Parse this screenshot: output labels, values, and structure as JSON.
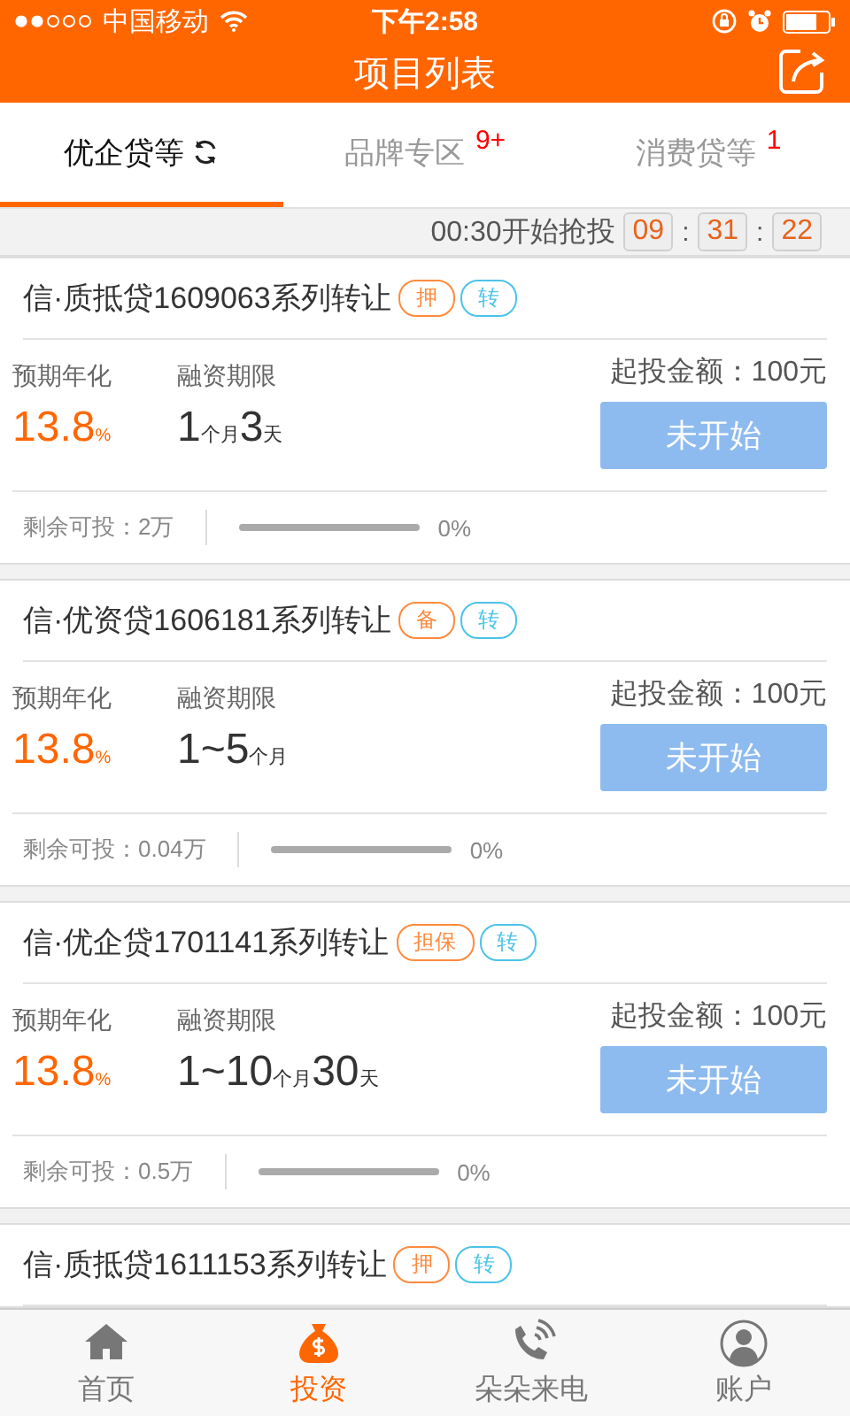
{
  "status_bar": {
    "carrier": "中国移动",
    "time": "下午2:58"
  },
  "nav": {
    "title": "项目列表"
  },
  "tabs": [
    {
      "label": "优企贷等",
      "selected": true,
      "refresh": true
    },
    {
      "label": "品牌专区",
      "selected": false,
      "badge": "9+"
    },
    {
      "label": "消费贷等",
      "selected": false,
      "badge": "1"
    }
  ],
  "countdown": {
    "label": "00:30开始抢投",
    "hours": "09",
    "sep1": ":",
    "minutes": "31",
    "sep2": ":",
    "seconds": "22"
  },
  "projects": [
    {
      "title": "信·质抵贷1609063系列转让",
      "tags": [
        {
          "text": "押",
          "color": "#ff8a3d"
        },
        {
          "text": "转",
          "color": "#4cc3e8"
        }
      ],
      "rate_label": "预期年化",
      "rate": "13.8",
      "rate_unit": "%",
      "term_label": "融资期限",
      "term": [
        {
          "text": "1",
          "kind": "number"
        },
        {
          "text": "个月",
          "kind": "unit"
        },
        {
          "text": "3",
          "kind": "number"
        },
        {
          "text": "天",
          "kind": "unit"
        }
      ],
      "min_invest": "起投金额：100元",
      "button": "未开始",
      "remaining": "剩余可投：2万",
      "level": 0,
      "percent": "0%"
    },
    {
      "title": "信·优资贷1606181系列转让",
      "tags": [
        {
          "text": "备",
          "color": "#ff8a3d"
        },
        {
          "text": "转",
          "color": "#4cc3e8"
        }
      ],
      "rate_label": "预期年化",
      "rate": "13.8",
      "rate_unit": "%",
      "term_label": "融资期限",
      "term": [
        {
          "text": "1~5",
          "kind": "number"
        },
        {
          "text": "个月",
          "kind": "unit"
        }
      ],
      "min_invest": "起投金额：100元",
      "button": "未开始",
      "remaining": "剩余可投：0.04万",
      "level": 0,
      "percent": "0%"
    },
    {
      "title": "信·优企贷1701141系列转让",
      "tags": [
        {
          "text": "担保",
          "color": "#ff8a3d"
        },
        {
          "text": "转",
          "color": "#4cc3e8"
        }
      ],
      "rate_label": "预期年化",
      "rate": "13.8",
      "rate_unit": "%",
      "term_label": "融资期限",
      "term": [
        {
          "text": "1~10",
          "kind": "number"
        },
        {
          "text": "个月",
          "kind": "unit"
        },
        {
          "text": "30",
          "kind": "number"
        },
        {
          "text": "天",
          "kind": "unit"
        }
      ],
      "min_invest": "起投金额：100元",
      "button": "未开始",
      "remaining": "剩余可投：0.5万",
      "level": 0,
      "percent": "0%"
    },
    {
      "title": "信·质抵贷1611153系列转让",
      "tags": [
        {
          "text": "押",
          "color": "#ff8a3d"
        },
        {
          "text": "转",
          "color": "#4cc3e8"
        }
      ]
    }
  ],
  "tab_bar": [
    {
      "label": "首页",
      "kind": "home",
      "selected": false
    },
    {
      "label": "投资",
      "kind": "money",
      "selected": true
    },
    {
      "label": "朵朵来电",
      "kind": "phone",
      "selected": false
    },
    {
      "label": "账户",
      "kind": "user",
      "selected": false
    }
  ]
}
